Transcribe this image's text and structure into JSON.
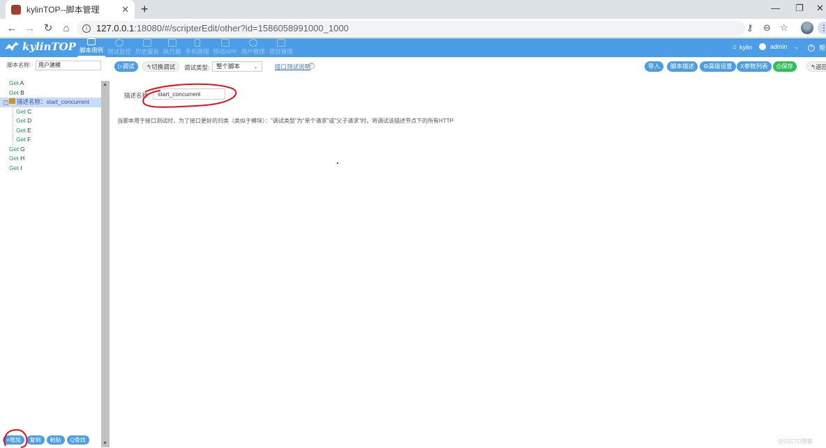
{
  "browser": {
    "tab_title": "kylinTOP--脚本管理",
    "new_tab_symbol": "+",
    "url_host": "127.0.0.1",
    "url_path": ":18080/#/scripterEdit/other?id=1586058991000_1000"
  },
  "app": {
    "brand": "kylinTOP",
    "nav": [
      {
        "label": "脚本用例",
        "active": true
      },
      {
        "label": "测试监控",
        "active": false
      },
      {
        "label": "历史报告",
        "active": false
      },
      {
        "label": "执行器",
        "active": false
      },
      {
        "label": "手机管理",
        "active": false
      },
      {
        "label": "移动APP",
        "active": false
      },
      {
        "label": "用户管理",
        "active": false
      },
      {
        "label": "项目管理",
        "active": false
      }
    ],
    "user_project": "kylin",
    "user_name": "admin",
    "help_label": "帮"
  },
  "left_panel": {
    "script_name_label": "脚本名称:",
    "script_name_value": "用户建模",
    "tree": [
      {
        "method": "Get",
        "path": "A",
        "level": 0
      },
      {
        "method": "Get",
        "path": "B",
        "level": 0
      },
      {
        "label": "描述名称：start_concurrent",
        "level": 0,
        "group": true,
        "selected": true
      },
      {
        "method": "Get",
        "path": "C",
        "level": 1
      },
      {
        "method": "Get",
        "path": "D",
        "level": 1
      },
      {
        "method": "Get",
        "path": "E",
        "level": 1
      },
      {
        "method": "Get",
        "path": "F",
        "level": 1
      },
      {
        "method": "Get",
        "path": "G",
        "level": 0
      },
      {
        "method": "Get",
        "path": "H",
        "level": 0
      },
      {
        "method": "Get",
        "path": "I",
        "level": 0
      }
    ],
    "footer_buttons": [
      "+增加",
      "复制",
      "粘贴",
      "Q查找"
    ]
  },
  "toolbar": {
    "debug_label": "▷调试",
    "switch_debug_label": "↰切换调试",
    "debug_type_label": "调试类型:",
    "debug_type_value": "整个脚本",
    "api_test_link": "接口测试说明",
    "import_label": "导入",
    "script_desc_label": "脚本描述",
    "advanced_label": "⚙高级设置",
    "params_label": "X参数列表",
    "save_label": "保存",
    "back_label": "↰返回"
  },
  "main": {
    "desc_name_label": "描述名称",
    "desc_name_value": "start_concurrent",
    "hint": "当脚本用于接口测试时，为了接口更好的归类（类似于模块）：\"调试类型\"为\"单个请求\"或\"父子请求\"时，将调试该描述节点下的所有HTTP"
  },
  "watermark": "@51CTO博客",
  "colors": {
    "header_blue": "#4b9de8",
    "method_green": "#1aa14a",
    "save_green": "#2fbf5a",
    "selected_row": "#c9dcf7",
    "annotation_red": "#e0111b"
  }
}
